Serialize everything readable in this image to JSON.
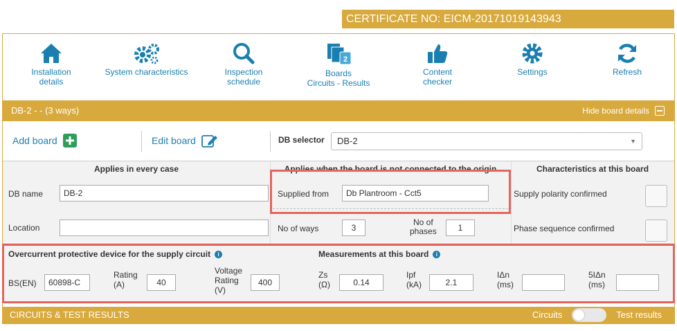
{
  "certificate": {
    "label": "CERTIFICATE NO: EICM-20171019143943"
  },
  "toolbar": {
    "items": [
      {
        "label": "Installation\ndetails",
        "icon": "home-icon"
      },
      {
        "label": "System characteristics",
        "icon": "gears-icon"
      },
      {
        "label": "Inspection\nschedule",
        "icon": "search-icon"
      },
      {
        "label": "Boards\nCircuits - Results",
        "icon": "boards-icon",
        "badge": "2"
      },
      {
        "label": "Content\nchecker",
        "icon": "thumbs-up-icon"
      },
      {
        "label": "Settings",
        "icon": "gear-icon"
      },
      {
        "label": "Refresh",
        "icon": "refresh-icon"
      }
    ]
  },
  "board_bar": {
    "title": "DB-2 -  - (3 ways)",
    "hide_label": "Hide board details"
  },
  "actions": {
    "add_board": "Add board",
    "edit_board": "Edit board",
    "db_selector_label": "DB selector",
    "db_selector_value": "DB-2"
  },
  "grid": {
    "headers": {
      "every_case": "Applies in every case",
      "not_origin": "Applies when the board is not connected to the origin",
      "characteristics": "Characteristics at this board"
    },
    "db_name_label": "DB name",
    "db_name_value": "DB-2",
    "location_label": "Location",
    "location_value": "",
    "supplied_from_label": "Supplied from",
    "supplied_from_value": "Db Plantroom - Cct5",
    "no_of_ways_label": "No of ways",
    "no_of_ways_value": "3",
    "no_of_phases_label": "No of\nphases",
    "no_of_phases_value": "1",
    "supply_polarity_label": "Supply polarity confirmed",
    "phase_sequence_label": "Phase sequence confirmed"
  },
  "ocpd": {
    "title": "Overcurrent protective device for the supply circuit",
    "bs_label": "BS(EN)",
    "bs_value": "60898-C",
    "rating_label": "Rating\n(A)",
    "rating_value": "40",
    "voltage_label": "Voltage\nRating\n(V)",
    "voltage_value": "400"
  },
  "measurements": {
    "title": "Measurements at this board",
    "zs_label": "Zs\n(Ω)",
    "zs_value": "0.14",
    "ipf_label": "Ipf\n(kA)",
    "ipf_value": "2.1",
    "idn_label": "IΔn\n(ms)",
    "idn_value": "",
    "fidn_label": "5IΔn\n(ms)",
    "fidn_value": ""
  },
  "footer": {
    "title": "CIRCUITS & TEST RESULTS",
    "circuits_label": "Circuits",
    "test_results_label": "Test results"
  },
  "colors": {
    "gold": "#d8a93c",
    "link_blue": "#1a7fb0",
    "highlight_red": "#e3655b",
    "add_green": "#2e9e5b"
  }
}
